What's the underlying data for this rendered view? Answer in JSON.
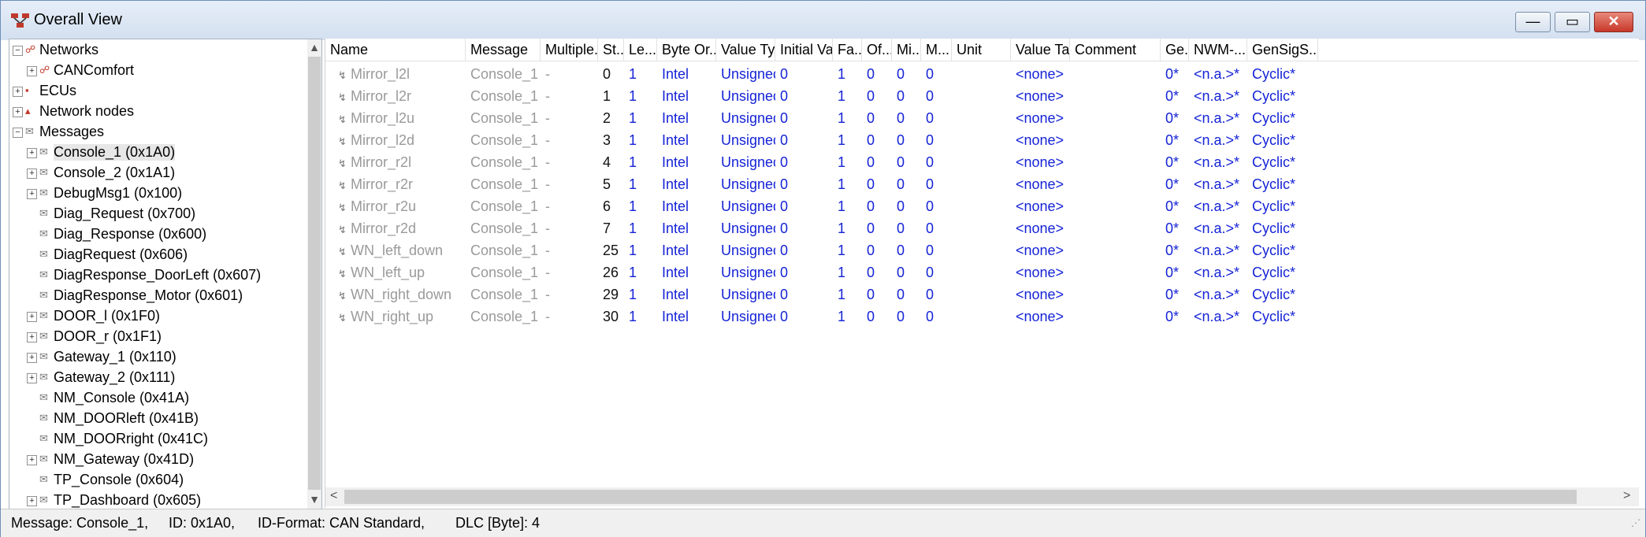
{
  "window": {
    "title": "Overall View"
  },
  "icons": {
    "minimize": "minimize-icon",
    "maximize": "maximize-icon",
    "close": "close-icon"
  },
  "tree": {
    "items": [
      {
        "label": "Networks",
        "level": 0,
        "expand": "−",
        "icon": "network-icon"
      },
      {
        "label": "CANComfort",
        "level": 1,
        "expand": "+",
        "icon": "network-icon"
      },
      {
        "label": "ECUs",
        "level": 0,
        "expand": "+",
        "icon": "ecu-icon"
      },
      {
        "label": "Network nodes",
        "level": 0,
        "expand": "+",
        "icon": "node-icon"
      },
      {
        "label": "Messages",
        "level": 0,
        "expand": "−",
        "icon": "message-icon"
      },
      {
        "label": "Console_1 (0x1A0)",
        "level": 1,
        "expand": "+",
        "icon": "message-icon",
        "selected": true
      },
      {
        "label": "Console_2 (0x1A1)",
        "level": 1,
        "expand": "+",
        "icon": "message-icon"
      },
      {
        "label": "DebugMsg1 (0x100)",
        "level": 1,
        "expand": "+",
        "icon": "message-icon"
      },
      {
        "label": "Diag_Request (0x700)",
        "level": 1,
        "expand": "",
        "icon": "message-icon"
      },
      {
        "label": "Diag_Response (0x600)",
        "level": 1,
        "expand": "",
        "icon": "message-icon"
      },
      {
        "label": "DiagRequest (0x606)",
        "level": 1,
        "expand": "",
        "icon": "message-icon"
      },
      {
        "label": "DiagResponse_DoorLeft (0x607)",
        "level": 1,
        "expand": "",
        "icon": "message-icon"
      },
      {
        "label": "DiagResponse_Motor (0x601)",
        "level": 1,
        "expand": "",
        "icon": "message-icon"
      },
      {
        "label": "DOOR_l (0x1F0)",
        "level": 1,
        "expand": "+",
        "icon": "message-icon"
      },
      {
        "label": "DOOR_r (0x1F1)",
        "level": 1,
        "expand": "+",
        "icon": "message-icon"
      },
      {
        "label": "Gateway_1 (0x110)",
        "level": 1,
        "expand": "+",
        "icon": "message-icon"
      },
      {
        "label": "Gateway_2 (0x111)",
        "level": 1,
        "expand": "+",
        "icon": "message-icon"
      },
      {
        "label": "NM_Console (0x41A)",
        "level": 1,
        "expand": "",
        "icon": "message-icon"
      },
      {
        "label": "NM_DOORleft (0x41B)",
        "level": 1,
        "expand": "",
        "icon": "message-icon"
      },
      {
        "label": "NM_DOORright (0x41C)",
        "level": 1,
        "expand": "",
        "icon": "message-icon"
      },
      {
        "label": "NM_Gateway (0x41D)",
        "level": 1,
        "expand": "+",
        "icon": "message-icon"
      },
      {
        "label": "TP_Console (0x604)",
        "level": 1,
        "expand": "",
        "icon": "message-icon"
      },
      {
        "label": "TP_Dashboard (0x605)",
        "level": 1,
        "expand": "+",
        "icon": "message-icon"
      }
    ]
  },
  "grid": {
    "columns": [
      "Name",
      "Message",
      "Multiple...",
      "St...",
      "Le...",
      "Byte Or...",
      "Value Ty...",
      "Initial Va...",
      "Fa...",
      "Of...",
      "Mi...",
      "M...",
      "Unit",
      "Value Ta...",
      "Comment",
      "Ge...",
      "NWM-...",
      "GenSigS..."
    ],
    "rows": [
      [
        "Mirror_l2l",
        "Console_1",
        "-",
        "0",
        "1",
        "Intel",
        "Unsigned",
        "0",
        "1",
        "0",
        "0",
        "0",
        "",
        "<none>",
        "",
        "0*",
        "<n.a.>*",
        "Cyclic*"
      ],
      [
        "Mirror_l2r",
        "Console_1",
        "-",
        "1",
        "1",
        "Intel",
        "Unsigned",
        "0",
        "1",
        "0",
        "0",
        "0",
        "",
        "<none>",
        "",
        "0*",
        "<n.a.>*",
        "Cyclic*"
      ],
      [
        "Mirror_l2u",
        "Console_1",
        "-",
        "2",
        "1",
        "Intel",
        "Unsigned",
        "0",
        "1",
        "0",
        "0",
        "0",
        "",
        "<none>",
        "",
        "0*",
        "<n.a.>*",
        "Cyclic*"
      ],
      [
        "Mirror_l2d",
        "Console_1",
        "-",
        "3",
        "1",
        "Intel",
        "Unsigned",
        "0",
        "1",
        "0",
        "0",
        "0",
        "",
        "<none>",
        "",
        "0*",
        "<n.a.>*",
        "Cyclic*"
      ],
      [
        "Mirror_r2l",
        "Console_1",
        "-",
        "4",
        "1",
        "Intel",
        "Unsigned",
        "0",
        "1",
        "0",
        "0",
        "0",
        "",
        "<none>",
        "",
        "0*",
        "<n.a.>*",
        "Cyclic*"
      ],
      [
        "Mirror_r2r",
        "Console_1",
        "-",
        "5",
        "1",
        "Intel",
        "Unsigned",
        "0",
        "1",
        "0",
        "0",
        "0",
        "",
        "<none>",
        "",
        "0*",
        "<n.a.>*",
        "Cyclic*"
      ],
      [
        "Mirror_r2u",
        "Console_1",
        "-",
        "6",
        "1",
        "Intel",
        "Unsigned",
        "0",
        "1",
        "0",
        "0",
        "0",
        "",
        "<none>",
        "",
        "0*",
        "<n.a.>*",
        "Cyclic*"
      ],
      [
        "Mirror_r2d",
        "Console_1",
        "-",
        "7",
        "1",
        "Intel",
        "Unsigned",
        "0",
        "1",
        "0",
        "0",
        "0",
        "",
        "<none>",
        "",
        "0*",
        "<n.a.>*",
        "Cyclic*"
      ],
      [
        "WN_left_down",
        "Console_1",
        "-",
        "25",
        "1",
        "Intel",
        "Unsigned",
        "0",
        "1",
        "0",
        "0",
        "0",
        "",
        "<none>",
        "",
        "0*",
        "<n.a.>*",
        "Cyclic*"
      ],
      [
        "WN_left_up",
        "Console_1",
        "-",
        "26",
        "1",
        "Intel",
        "Unsigned",
        "0",
        "1",
        "0",
        "0",
        "0",
        "",
        "<none>",
        "",
        "0*",
        "<n.a.>*",
        "Cyclic*"
      ],
      [
        "WN_right_down",
        "Console_1",
        "-",
        "29",
        "1",
        "Intel",
        "Unsigned",
        "0",
        "1",
        "0",
        "0",
        "0",
        "",
        "<none>",
        "",
        "0*",
        "<n.a.>*",
        "Cyclic*"
      ],
      [
        "WN_right_up",
        "Console_1",
        "-",
        "30",
        "1",
        "Intel",
        "Unsigned",
        "0",
        "1",
        "0",
        "0",
        "0",
        "",
        "<none>",
        "",
        "0*",
        "<n.a.>*",
        "Cyclic*"
      ]
    ]
  },
  "status": {
    "message": "Message: Console_1,",
    "id": "ID: 0x1A0,",
    "id_format": "ID-Format: CAN Standard,",
    "dlc": "DLC [Byte]: 4"
  }
}
